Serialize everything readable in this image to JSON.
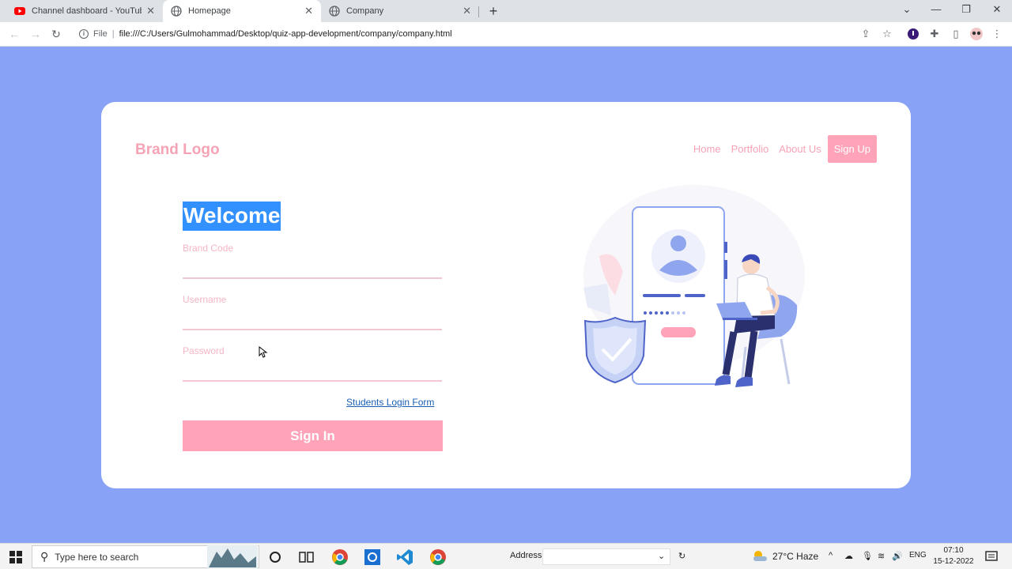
{
  "browser": {
    "tabs": [
      {
        "title": "Channel dashboard - YouTube St",
        "icon": "youtube-icon",
        "active": false
      },
      {
        "title": "Homepage",
        "icon": "globe-icon",
        "active": true
      },
      {
        "title": "Company",
        "icon": "globe-icon",
        "active": false
      }
    ],
    "new_tab": "+",
    "url_scheme_label": "File",
    "url": "file:///C:/Users/Gulmohammad/Desktop/quiz-app-development/company/company.html"
  },
  "page": {
    "brand_logo": "Brand Logo",
    "nav": {
      "home": "Home",
      "portfolio": "Portfolio",
      "about": "About Us",
      "signup": "Sign Up"
    },
    "form": {
      "heading": "Welcome",
      "brand_code_label": "Brand Code",
      "username_label": "Username",
      "password_label": "Password",
      "students_link": "Students Login Form",
      "signin_button": "Sign In"
    },
    "colors": {
      "background": "#88a3f5",
      "accent_pink": "#ffa3b9",
      "selection": "#3390ff"
    }
  },
  "taskbar": {
    "search_placeholder": "Type here to search",
    "address_label": "Address",
    "weather": "27°C Haze",
    "language": "ENG",
    "time": "07:10",
    "date": "15-12-2022"
  }
}
